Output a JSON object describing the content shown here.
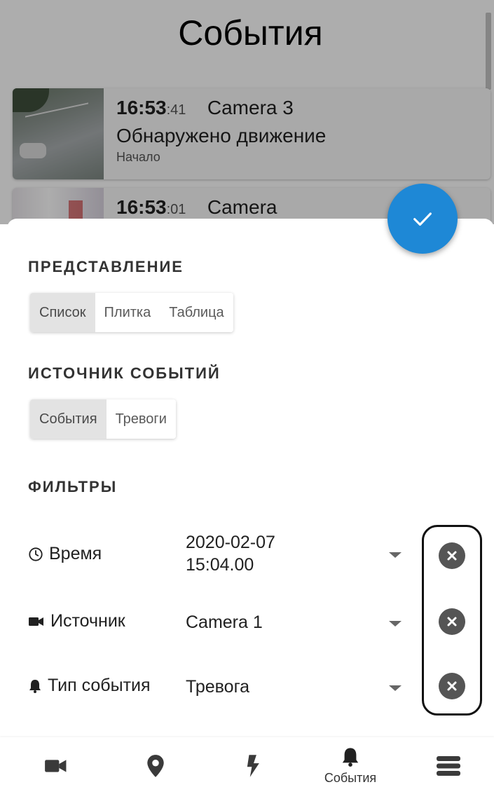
{
  "background": {
    "title": "События",
    "events": [
      {
        "time_hm": "16:53",
        "time_s": ":41",
        "camera": "Camera 3",
        "description": "Обнаружено движение",
        "phase": "Начало"
      },
      {
        "time_hm": "16:53",
        "time_s": ":01",
        "camera": "Camera"
      }
    ]
  },
  "sheet": {
    "view_section": {
      "title": "ПРЕДСТАВЛЕНИЕ",
      "options": [
        "Список",
        "Плитка",
        "Таблица"
      ],
      "selected": "Список"
    },
    "source_section": {
      "title": "ИСТОЧНИК СОБЫТИЙ",
      "options": [
        "События",
        "Тревоги"
      ],
      "selected": "События"
    },
    "filters_section": {
      "title": "ФИЛЬТРЫ",
      "filters": [
        {
          "label": "Время",
          "icon": "clock-icon",
          "value_line1": "2020-02-07",
          "value_line2": "15:04.00"
        },
        {
          "label": "Источник",
          "icon": "videocam-icon",
          "value_line1": "Camera 1"
        },
        {
          "label": "Тип события",
          "icon": "bell-icon",
          "value_line1": "Тревога"
        }
      ]
    }
  },
  "nav": {
    "items": [
      {
        "icon": "videocam-icon"
      },
      {
        "icon": "map-pin-icon"
      },
      {
        "icon": "lightning-icon"
      },
      {
        "icon": "bell-icon",
        "label": "События",
        "active": true
      },
      {
        "icon": "server-list-icon"
      }
    ]
  },
  "colors": {
    "accent": "#1e88d6",
    "clear_button": "#555555",
    "segment_active": "#e3e3e3"
  }
}
